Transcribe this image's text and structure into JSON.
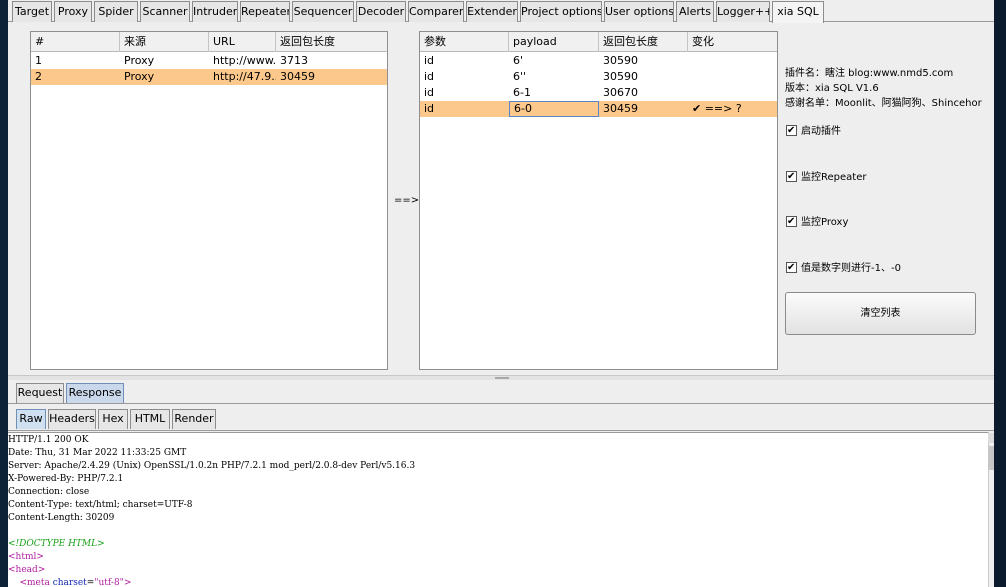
{
  "main_tabs": [
    "Target",
    "Proxy",
    "Spider",
    "Scanner",
    "Intruder",
    "Repeater",
    "Sequencer",
    "Decoder",
    "Comparer",
    "Extender",
    "Project options",
    "User options",
    "Alerts",
    "Logger++",
    "xia SQL"
  ],
  "left_table": {
    "headers": [
      "#",
      "来源",
      "URL",
      "返回包长度"
    ],
    "rows": [
      {
        "num": "1",
        "source": "Proxy",
        "url": "http://www...",
        "length": "3713"
      },
      {
        "num": "2",
        "source": "Proxy",
        "url": "http://47.9...",
        "length": "30459"
      }
    ]
  },
  "arrow_label": "==>",
  "right_table": {
    "headers": [
      "参数",
      "payload",
      "返回包长度",
      "变化"
    ],
    "rows": [
      {
        "param": "id",
        "payload": "6'",
        "length": "30590",
        "change": ""
      },
      {
        "param": "id",
        "payload": "6''",
        "length": "30590",
        "change": ""
      },
      {
        "param": "id",
        "payload": "6-1",
        "length": "30670",
        "change": ""
      },
      {
        "param": "id",
        "payload": "6-0",
        "length": "30459",
        "change": "✔ ==> ?"
      }
    ]
  },
  "plugin_info": {
    "name_line": "插件名：瞎注 blog:www.nmd5.com",
    "version_line": "版本：xia SQL V1.6",
    "thanks_line": "感谢名单：Moonlit、阿猫阿狗、Shincehor"
  },
  "options": [
    {
      "label": "启动插件",
      "checked": true
    },
    {
      "label": "监控Repeater",
      "checked": true
    },
    {
      "label": "监控Proxy",
      "checked": true
    },
    {
      "label": "值是数字则进行-1、-0",
      "checked": true
    }
  ],
  "clear_button": "清空列表",
  "message_tabs": [
    "Request",
    "Response"
  ],
  "view_tabs": [
    "Raw",
    "Headers",
    "Hex",
    "HTML",
    "Render"
  ],
  "response": {
    "headers": [
      "HTTP/1.1 200 OK",
      "Date: Thu, 31 Mar 2022 11:33:25 GMT",
      "Server: Apache/2.4.29 (Unix) OpenSSL/1.0.2n PHP/7.2.1 mod_perl/2.0.8-dev Perl/v5.16.3",
      "X-Powered-By: PHP/7.2.1",
      "Connection: close",
      "Content-Type: text/html; charset=UTF-8",
      "Content-Length: 30209"
    ],
    "doctype": "<!DOCTYPE HTML>",
    "html_open": "<html>",
    "head_open": "<head>",
    "meta_indent": "    ",
    "meta_lt": "<",
    "meta_tag": "meta",
    "meta_attr": "charset",
    "meta_eq": "=",
    "meta_val": "\"utf-8\"",
    "meta_gt": ">"
  }
}
